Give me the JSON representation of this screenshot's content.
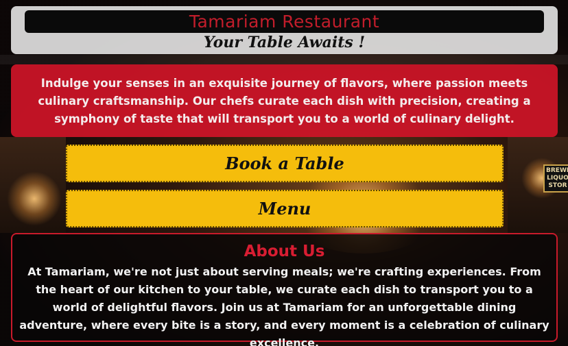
{
  "header": {
    "title": "Tamariam Restaurant",
    "subtitle": "Your Table Awaits !"
  },
  "intro": {
    "text": "Indulge your senses in an exquisite journey of flavors, where passion meets culinary craftsmanship. Our chefs curate each dish with precision, creating a symphony of taste that will transport you to a world of culinary delight."
  },
  "actions": {
    "book_label": "Book a Table",
    "menu_label": "Menu"
  },
  "about": {
    "title": "About Us",
    "text": "At Tamariam, we're not just about serving meals; we're crafting experiences. From the heart of our kitchen to your table, we curate each dish to transport you to a world of delightful flavors. Join us at Tamariam for an unforgettable dining adventure, where every bite is a story, and every moment is a celebration of culinary excellence."
  },
  "background": {
    "sign_text": "BREWE LIQUO STOR"
  },
  "colors": {
    "title_red": "#c21d2b",
    "intro_red": "#cd1428",
    "button_yellow": "#f5bd0c",
    "about_border": "#c91a2b"
  }
}
